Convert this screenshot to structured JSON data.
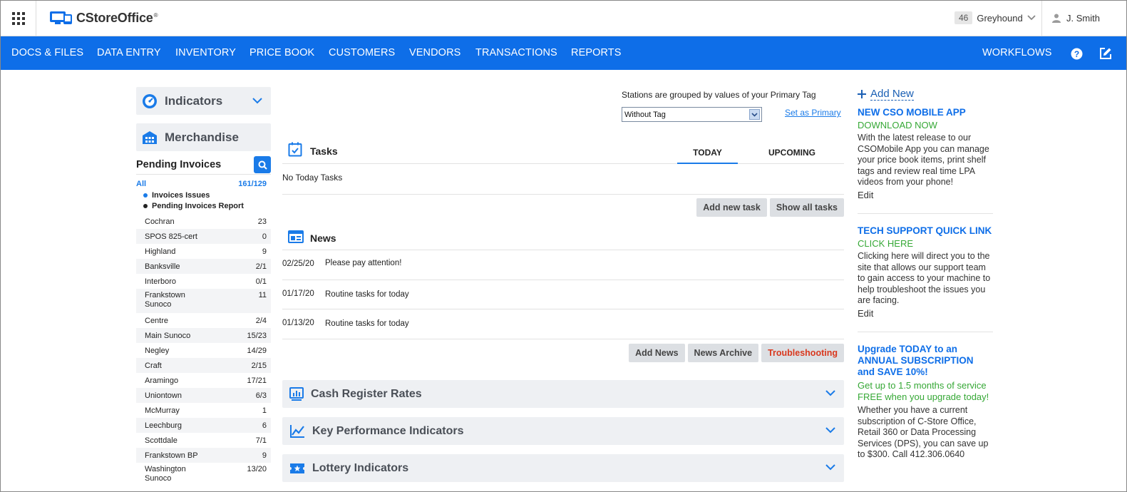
{
  "header": {
    "app_name": "CStoreOffice",
    "store_count": "46",
    "store_name": "Greyhound",
    "user_name": "J. Smith"
  },
  "nav": {
    "items": [
      "DOCS & FILES",
      "DATA ENTRY",
      "INVENTORY",
      "PRICE BOOK",
      "CUSTOMERS",
      "VENDORS",
      "TRANSACTIONS",
      "REPORTS"
    ],
    "workflows": "WORKFLOWS"
  },
  "left": {
    "indicators": "Indicators",
    "merchandise": "Merchandise",
    "pending_title": "Pending Invoices",
    "all_label": "All",
    "all_count": "161/129",
    "links": [
      "Invoices Issues",
      "Pending Invoices Report"
    ],
    "stores": [
      {
        "name": "Cochran",
        "value": "23"
      },
      {
        "name": "SPOS 825-cert",
        "value": "0"
      },
      {
        "name": "Highland",
        "value": "9"
      },
      {
        "name": "Banksville",
        "value": "2/1"
      },
      {
        "name": "Interboro",
        "value": "0/1"
      },
      {
        "name": "Frankstown Sunoco",
        "value": "11"
      },
      {
        "name": "Centre",
        "value": "2/4"
      },
      {
        "name": "Main Sunoco",
        "value": "15/23"
      },
      {
        "name": "Negley",
        "value": "14/29"
      },
      {
        "name": "Craft",
        "value": "2/15"
      },
      {
        "name": "Aramingo",
        "value": "17/21"
      },
      {
        "name": "Uniontown",
        "value": "6/3"
      },
      {
        "name": "McMurray",
        "value": "1"
      },
      {
        "name": "Leechburg",
        "value": "6"
      },
      {
        "name": "Scottdale",
        "value": "7/1"
      },
      {
        "name": "Frankstown BP",
        "value": "9"
      },
      {
        "name": "Washington Sunoco",
        "value": "13/20"
      }
    ]
  },
  "center": {
    "group_caption": "Stations are grouped by values of your Primary Tag",
    "tag_value": "Without Tag",
    "set_primary": "Set as Primary",
    "tasks": {
      "title": "Tasks",
      "tab_today": "TODAY",
      "tab_upcoming": "UPCOMING",
      "empty": "No Today Tasks",
      "add_btn": "Add new task",
      "show_btn": "Show all tasks"
    },
    "news": {
      "title": "News",
      "items": [
        {
          "date": "02/25/20",
          "text": "Please pay attention!"
        },
        {
          "date": "01/17/20",
          "text": "Routine tasks for today"
        },
        {
          "date": "01/13/20",
          "text": "Routine tasks for today"
        }
      ],
      "add_btn": "Add News",
      "archive_btn": "News Archive",
      "trouble_btn": "Troubleshooting"
    },
    "sections": [
      "Cash Register Rates",
      "Key Performance Indicators",
      "Lottery Indicators"
    ]
  },
  "right": {
    "add_new": "Add New",
    "promos": [
      {
        "title": "NEW CSO MOBILE APP",
        "sub": "DOWNLOAD NOW",
        "body": "With the latest release to our CSOMobile App you can manage your price book items, print shelf tags and review real time LPA videos from your phone!",
        "edit": "Edit"
      },
      {
        "title": "TECH SUPPORT QUICK LINK",
        "sub": "CLICK HERE",
        "body": "Clicking here will direct you to the site that allows our support team to gain access to your machine to help troubleshoot the issues you are facing.",
        "edit": "Edit"
      },
      {
        "title": "Upgrade TODAY to an ANNUAL SUBSCRIPTION and SAVE 10%!",
        "sub": "Get up to 1.5 months of service FREE when you upgrade today!",
        "body": "Whether you have a current subscription of C-Store Office, Retail 360 or Data Processing Services (DPS), you can save up to $300. Call 412.306.0640"
      }
    ]
  },
  "colors": {
    "brand_blue": "#0e6ee8",
    "promo_green": "#36a836",
    "danger_red": "#d9381e"
  }
}
